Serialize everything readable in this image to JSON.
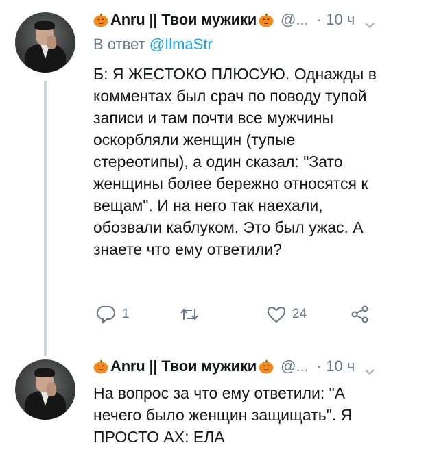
{
  "tweets": [
    {
      "author_name": "Anru || Твои мужики",
      "handle": "@...",
      "time": "· 10 ч",
      "reply_to_label": "В ответ",
      "reply_to_handle": "@IlmaStr",
      "text_lines": [
        "Б: Я ЖЕСТОКО ПЛЮСУЮ. Однажды в",
        "комментах был срач по поводу тупой",
        "записи и там почти все мужчины",
        "оскорбляли женщин (тупые",
        "стереотипы), а один сказал: \"Зато",
        "женщины более бережно относятся к",
        "вещам\". И на него так наехали,",
        "обозвали каблуком. Это был ужас. А",
        "знаете что ему ответили?"
      ],
      "actions": {
        "reply_count": "1",
        "retweet_count": "",
        "like_count": "24"
      }
    },
    {
      "author_name": "Anru || Твои мужики",
      "handle": "@...",
      "time": "· 10 ч",
      "text_lines": [
        "На вопрос за что ему ответили: \"А",
        "нечего было женщин защищать\". Я",
        "ПРОСТО АХ: ЕЛА"
      ]
    }
  ],
  "icons": {
    "pumpkin": "pumpkin-emoji",
    "reply": "reply-icon",
    "retweet": "retweet-icon",
    "like": "heart-icon",
    "share": "share-icon",
    "chevron": "chevron-down-icon"
  },
  "colors": {
    "text": "#14171a",
    "secondary": "#657786",
    "mention": "#1da1f2",
    "thread_line": "#ccd6dd"
  }
}
